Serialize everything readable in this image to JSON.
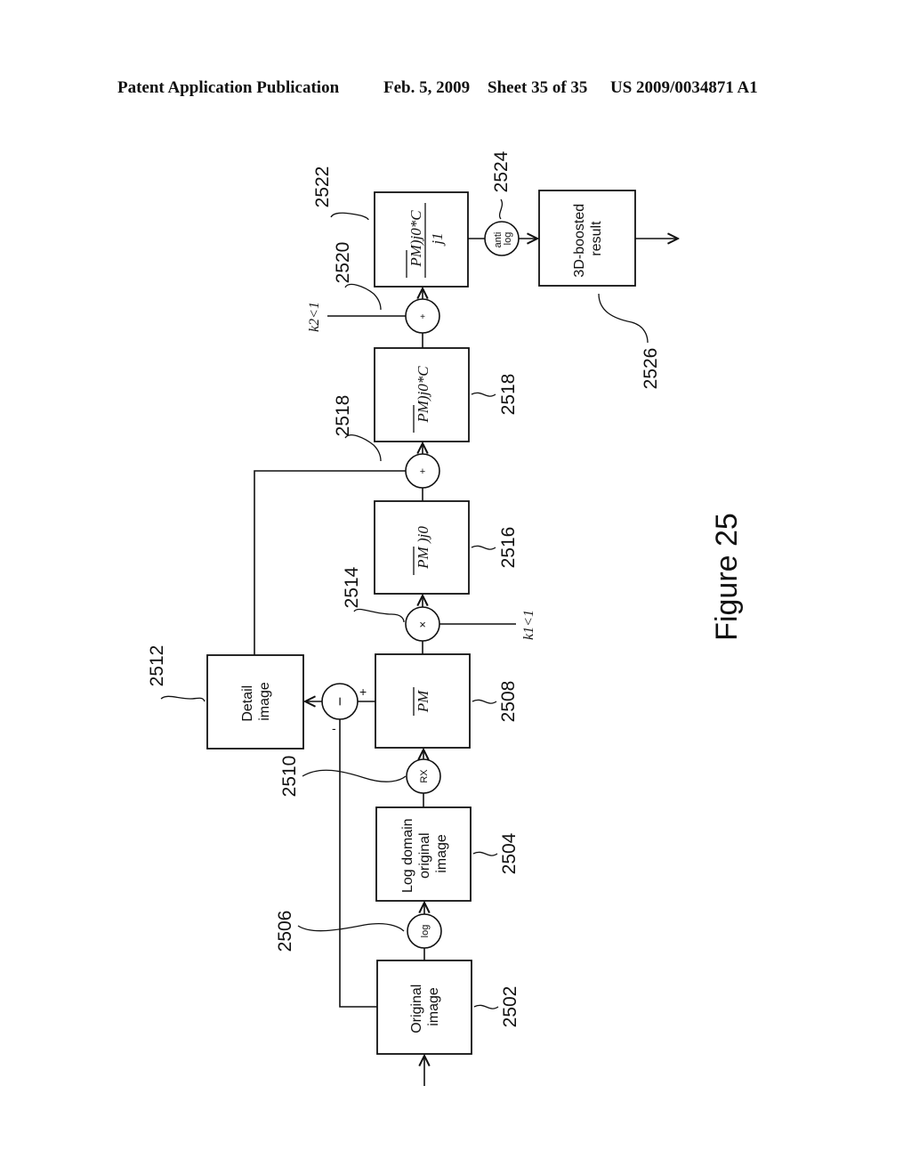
{
  "header": {
    "publication": "Patent Application Publication",
    "date": "Feb. 5, 2009",
    "sheet": "Sheet 35 of 35",
    "number": "US 2009/0034871 A1"
  },
  "figure": {
    "caption": "Figure 25",
    "blocks": {
      "original_image": {
        "ref": "2502",
        "lines": [
          "Original",
          "image"
        ]
      },
      "log_domain": {
        "ref": "2504",
        "lines": [
          "Log domain",
          "original",
          "image"
        ]
      },
      "pm_bar": {
        "ref": "2508",
        "formula": "PM"
      },
      "detail_image": {
        "ref": "2512",
        "lines": [
          "Detail",
          "image"
        ]
      },
      "pm_j0": {
        "ref": "2516",
        "formula_bar": "PM",
        "formula_rest": " )j0"
      },
      "pm_j0_c": {
        "ref": "2518",
        "formula_bar": "PM",
        "formula_rest": ")j0*C"
      },
      "pm_j0_c_j1": {
        "ref": "2522",
        "numerator_bar": "PM",
        "numerator_rest": ")j0*C",
        "denominator": "j1"
      },
      "boosted_result": {
        "ref": "2526",
        "lines": [
          "3D-boosted",
          "result"
        ]
      }
    },
    "operators": {
      "log": {
        "ref": "2506",
        "label": "log"
      },
      "rx": {
        "ref": "2510",
        "label": "RX"
      },
      "subtract": {
        "label": "−",
        "plus_sign": "+",
        "minus_sign": "-"
      },
      "multiply": {
        "ref": "2514",
        "label": "×"
      },
      "sum1": {
        "ref": "2518",
        "label": "+"
      },
      "sum2": {
        "ref": "2520",
        "label": "+"
      },
      "antilog": {
        "ref": "2524",
        "line1": "anti",
        "line2": "log"
      }
    },
    "constants": {
      "k1": "k1<1",
      "k2": "k2<1"
    }
  }
}
